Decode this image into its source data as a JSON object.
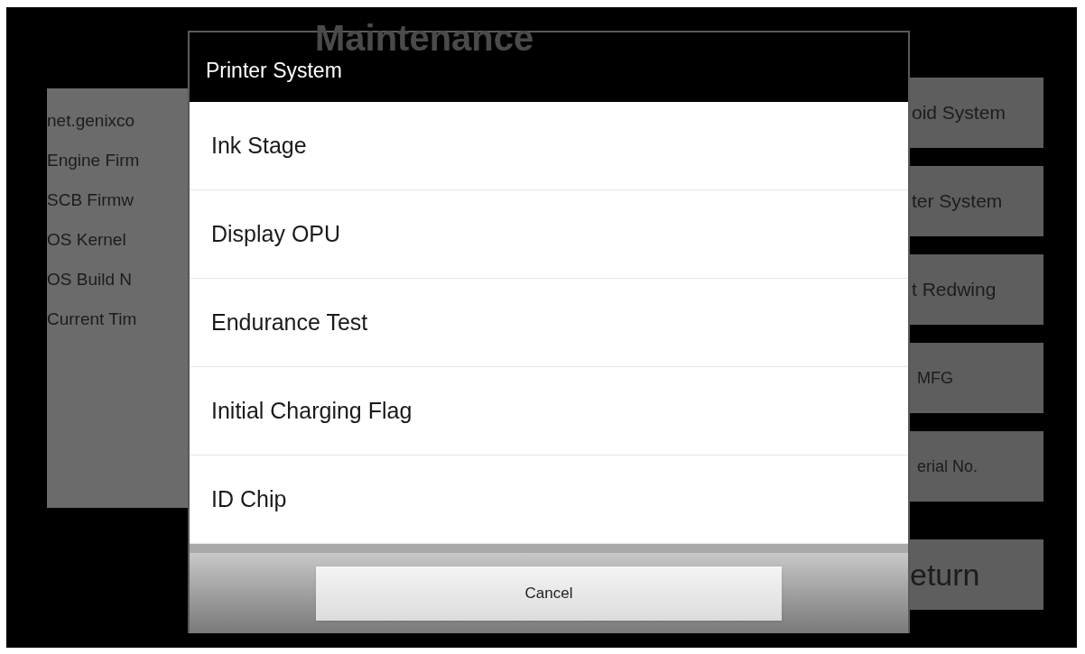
{
  "background": {
    "title": "Maintenance",
    "info_lines": [
      "net.genixco",
      "Engine Firm",
      "SCB Firmw",
      "OS Kernel",
      "OS Build N",
      "Current Tim"
    ],
    "buttons": [
      {
        "label": "oid System",
        "kind": "normal"
      },
      {
        "label": "ter System",
        "kind": "normal"
      },
      {
        "label": "t Redwing",
        "kind": "normal"
      },
      {
        "label": "MFG",
        "kind": "small"
      },
      {
        "label": "erial No.",
        "kind": "small"
      },
      {
        "label": "eturn",
        "kind": "large"
      }
    ]
  },
  "dialog": {
    "title": "Printer System",
    "items": [
      "Ink Stage",
      "Display OPU",
      "Endurance Test",
      "Initial Charging Flag",
      "ID Chip"
    ],
    "cancel": "Cancel"
  }
}
